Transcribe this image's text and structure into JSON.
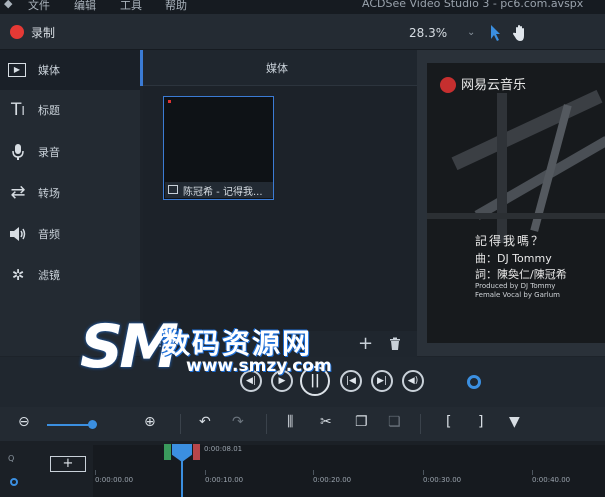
{
  "menu": {
    "items": [
      "文件",
      "编辑",
      "工具",
      "帮助"
    ],
    "window_title": "ACDSee Video Studio 3 - pc6.com.avspx"
  },
  "record": {
    "label": "录制"
  },
  "zoom": {
    "value": "28.3%"
  },
  "sidebar": {
    "items": [
      {
        "label": "媒体",
        "icon": "media-icon",
        "glyph": "▶"
      },
      {
        "label": "标题",
        "icon": "title-text-icon",
        "glyph": "T|"
      },
      {
        "label": "录音",
        "icon": "microphone-icon",
        "glyph": "🎤"
      },
      {
        "label": "转场",
        "icon": "transition-icon",
        "glyph": "⇄"
      },
      {
        "label": "音频",
        "icon": "speaker-icon",
        "glyph": "🔊"
      },
      {
        "label": "滤镜",
        "icon": "effects-wand-icon",
        "glyph": "✲"
      }
    ]
  },
  "media": {
    "title": "媒体",
    "clip_name": "陈冠希 - 记得我..."
  },
  "preview": {
    "brand": "网易云音乐",
    "song": "記得我嗎？",
    "composer": "曲：DJ Tommy",
    "lyricist": "詞：陳奐仁/陳冠希",
    "producer": "Produced by DJ Tommy",
    "vocal": "Female Vocal by Garlum"
  },
  "transport": {
    "buttons": [
      "rewind",
      "play",
      "pause",
      "previous",
      "next",
      "volume"
    ]
  },
  "timeline": {
    "playhead_time": "0:00:08.01",
    "timecodes": [
      "0:00:00.00",
      "0:00:10.00",
      "0:00:20.00",
      "0:00:30.00",
      "0:00:40.00"
    ],
    "add_track": "+"
  },
  "watermark": {
    "logo": "SM",
    "cn": "数码资源网",
    "url": "www.smzy.com"
  },
  "colors": {
    "accent": "#3b8fe0",
    "record": "#e53935",
    "brand": "#c62f2f"
  }
}
